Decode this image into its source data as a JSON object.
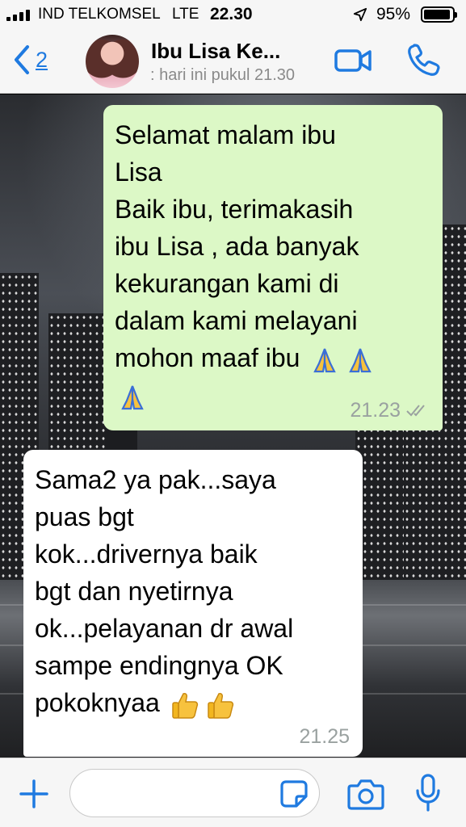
{
  "status_bar": {
    "carrier": "IND TELKOMSEL",
    "network": "LTE",
    "time": "22.30",
    "battery": "95%",
    "battery_level": 0.95
  },
  "header": {
    "back_count": "2",
    "contact_name": "Ibu Lisa Ke...",
    "last_seen": ": hari ini pukul 21.30",
    "accent_color": "#1f7ae0"
  },
  "messages": [
    {
      "direction": "outgoing",
      "text": "Selamat malam ibu\nLisa\nBaik ibu, terimakasih\nibu Lisa , ada banyak\nkekurangan kami di\ndalam kami melayani\nmohon maaf ibu",
      "emoji": [
        "folded-hands",
        "folded-hands",
        "folded-hands"
      ],
      "time": "21.23",
      "status": "delivered",
      "bubble_color": "#dcf8c6"
    },
    {
      "direction": "incoming",
      "text": "Sama2 ya pak...saya\npuas bgt\nkok...drivernya baik\nbgt dan nyetirnya\nok...pelayanan dr awal\nsampe endingnya OK\npokoknyaa",
      "emoji": [
        "thumbs-up",
        "thumbs-up"
      ],
      "time": "21.25",
      "bubble_color": "#ffffff"
    }
  ],
  "input_bar": {
    "placeholder": ""
  }
}
